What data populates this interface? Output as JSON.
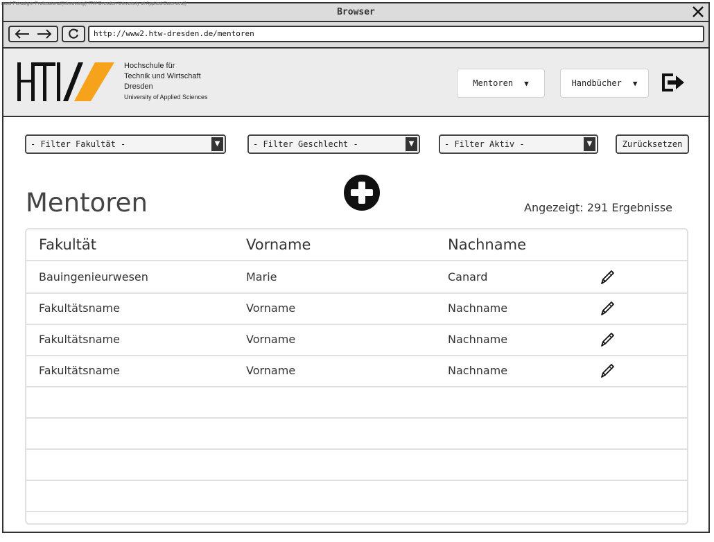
{
  "watermark": "isual Paradigm Professional(khwowing(HTW Dresden University of Applied Sciences))",
  "browser": {
    "title": "Browser",
    "url": "http://www2.htw-dresden.de/mentoren",
    "icons": {
      "back": "arrow-left-icon",
      "forward": "arrow-right-icon",
      "reload": "reload-icon",
      "close": "close-icon"
    }
  },
  "header": {
    "logo": {
      "letters": "HTW",
      "accent_color": "#f7a21b"
    },
    "institution": {
      "line1": "Hochschule für",
      "line2": "Technik und Wirtschaft",
      "line3": "Dresden",
      "line4": "University of Applied Sciences"
    },
    "nav": {
      "mentoren": "Mentoren",
      "handbuecher": "Handbücher"
    },
    "logout_icon": "logout-icon"
  },
  "filters": {
    "fakultaet": "- Filter Fakultät -",
    "geschlecht": "- Filter Geschlecht -",
    "aktiv": "- Filter Aktiv -",
    "reset": "Zurücksetzen"
  },
  "main": {
    "title": "Mentoren",
    "result_count": "Angezeigt: 291 Ergebnisse",
    "add_icon": "plus-circle-icon"
  },
  "table": {
    "columns": [
      "Fakultät",
      "Vorname",
      "Nachname"
    ],
    "rows": [
      [
        "Bauingenieurwesen",
        "Marie",
        "Canard"
      ],
      [
        "Fakultätsname",
        "Vorname",
        "Nachname"
      ],
      [
        "Fakultätsname",
        "Vorname",
        "Nachname"
      ],
      [
        "Fakultätsname",
        "Vorname",
        "Nachname"
      ]
    ],
    "empty_rows": 5,
    "row_action_icon": "pencil-edit-icon"
  }
}
